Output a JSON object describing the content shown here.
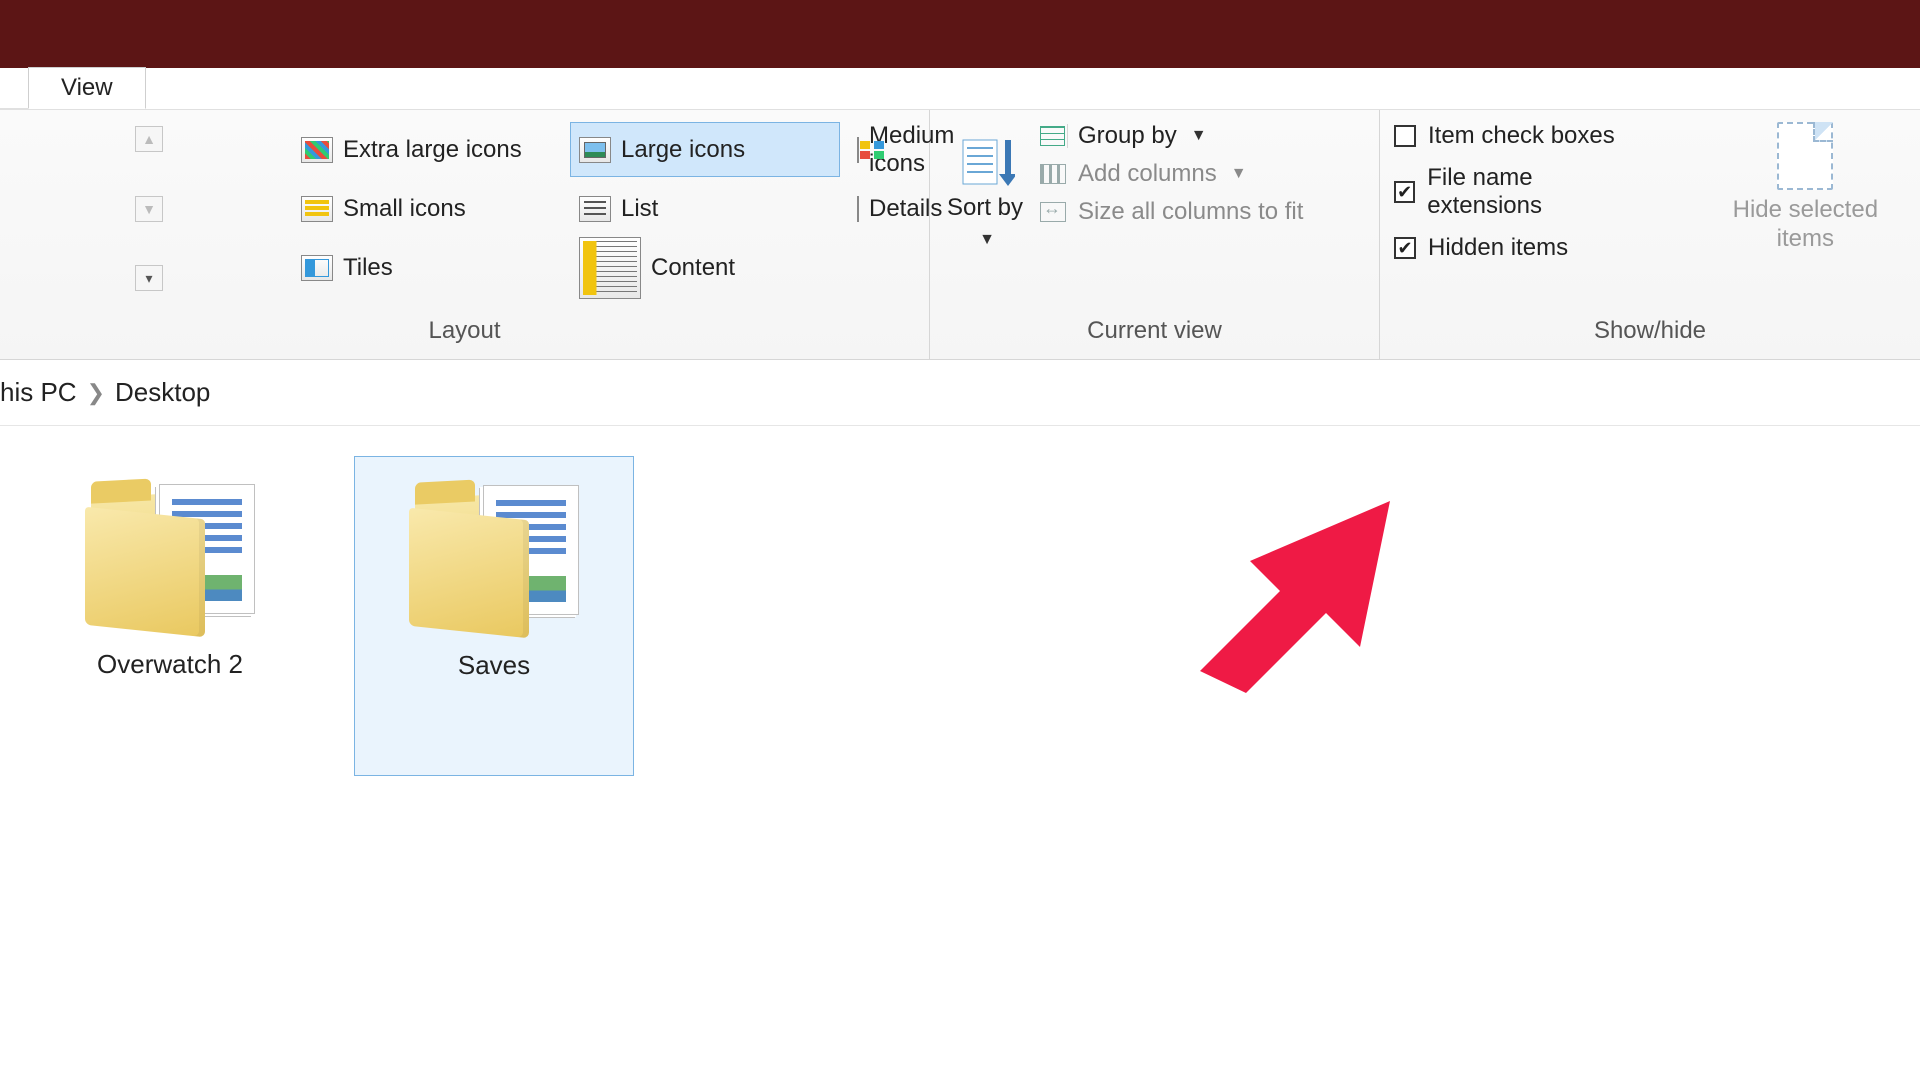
{
  "tab": {
    "label": "View"
  },
  "ribbon": {
    "layout": {
      "label": "Layout",
      "items": {
        "extra_large": "Extra large icons",
        "large": "Large icons",
        "medium": "Medium icons",
        "small": "Small icons",
        "list": "List",
        "details": "Details",
        "tiles": "Tiles",
        "content": "Content"
      },
      "selected": "large"
    },
    "current_view": {
      "label": "Current view",
      "sort_by": "Sort by",
      "group_by": "Group by",
      "add_columns": "Add columns",
      "size_all": "Size all columns to fit"
    },
    "show_hide": {
      "label": "Show/hide",
      "item_check_boxes": {
        "label": "Item check boxes",
        "checked": false
      },
      "file_ext": {
        "label": "File name extensions",
        "checked": true
      },
      "hidden_items": {
        "label": "Hidden items",
        "checked": true
      },
      "hide_selected": "Hide selected items"
    }
  },
  "breadcrumb": {
    "part0_fragment": "his PC",
    "part1": "Desktop"
  },
  "folders": [
    {
      "name": "Overwatch 2",
      "selected": false
    },
    {
      "name": "Saves",
      "selected": true
    }
  ],
  "annotation": {
    "arrow_color": "#ef1a45"
  }
}
